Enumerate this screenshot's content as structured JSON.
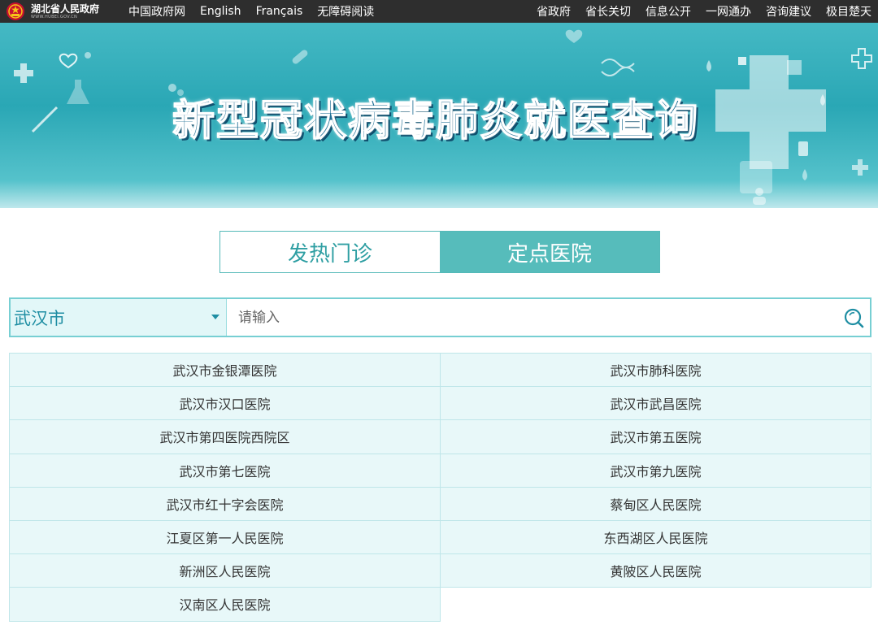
{
  "topbar": {
    "logo_title": "湖北省人民政府",
    "logo_sub": "WWW.HUBEI.GOV.CN",
    "left_links": [
      "中国政府网",
      "English",
      "Français",
      "无障碍阅读"
    ],
    "right_links": [
      "省政府",
      "省长关切",
      "信息公开",
      "一网通办",
      "咨询建议",
      "极目楚天"
    ]
  },
  "banner": {
    "title": "新型冠状病毒肺炎就医查询"
  },
  "tabs": {
    "fever": "发热门诊",
    "designated": "定点医院",
    "active": "designated"
  },
  "search": {
    "city": "武汉市",
    "placeholder": "请输入",
    "icon": "search-icon"
  },
  "hospitals": [
    "武汉市金银潭医院",
    "武汉市肺科医院",
    "武汉市汉口医院",
    "武汉市武昌医院",
    "武汉市第四医院西院区",
    "武汉市第五医院",
    "武汉市第七医院",
    "武汉市第九医院",
    "武汉市红十字会医院",
    "蔡甸区人民医院",
    "江夏区第一人民医院",
    "东西湖区人民医院",
    "新洲区人民医院",
    "黄陂区人民医院",
    "汉南区人民医院"
  ],
  "colors": {
    "accent": "#56bcbb",
    "banner": "#2aa7b5",
    "topbar": "#2e2e2e",
    "cell_bg": "#e8f8f9"
  }
}
